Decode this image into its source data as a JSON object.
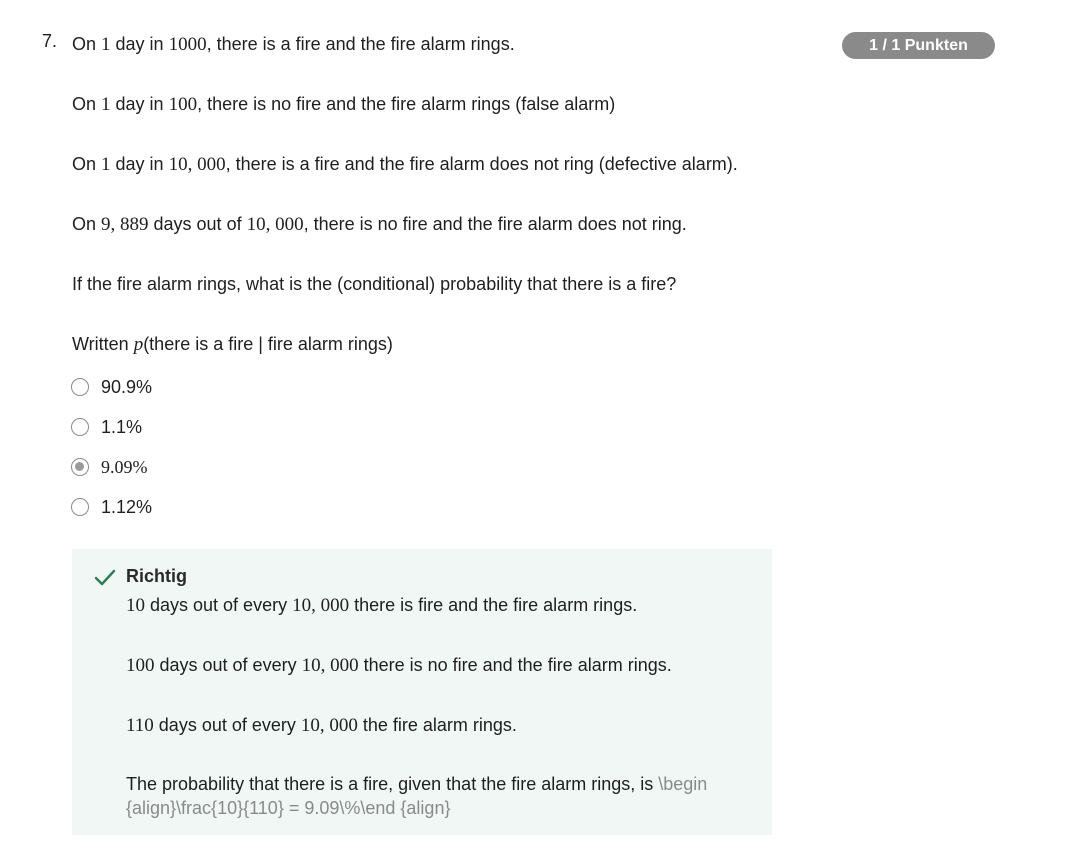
{
  "question": {
    "number": "7.",
    "score_badge": "1 / 1 Punkten",
    "paragraphs": [
      [
        "On ",
        "1",
        " day in ",
        "1000",
        ", there is a fire and the fire alarm rings."
      ],
      [
        "On ",
        "1",
        " day in ",
        "100",
        ", there is no fire and the fire alarm rings (false alarm)"
      ],
      [
        "On ",
        "1",
        " day in ",
        "10, 000",
        ", there is a fire and the fire alarm does not ring (defective alarm)."
      ],
      [
        "On ",
        "9, 889",
        " days out of ",
        "10, 000",
        ", there is no fire and the fire alarm does not ring."
      ]
    ],
    "prompt": "If the fire alarm rings, what is the (conditional) probability that there is a fire?",
    "notation": {
      "prefix": "Written ",
      "math": "p",
      "rest": "(there is a fire | fire alarm rings)"
    }
  },
  "options": [
    {
      "label": "90.9%",
      "selected": false
    },
    {
      "label": "1.1%",
      "selected": false
    },
    {
      "label": "9.09%",
      "selected": true
    },
    {
      "label": "1.12%",
      "selected": false
    }
  ],
  "feedback": {
    "status": "Richtig",
    "status_color": "#2e7d4f",
    "background_color": "#f0f7f5",
    "icon": "checkmark-icon",
    "lines": [
      [
        "10",
        " days out of every ",
        "10, 000",
        " there is fire and the fire alarm rings."
      ],
      [
        "100",
        " days out of every ",
        "10, 000",
        " there is no fire and the fire alarm rings."
      ],
      [
        "110",
        " days out of every ",
        "10, 000",
        " the fire alarm rings."
      ]
    ],
    "conclusion_text": "The probability that there is a fire, given that the fire alarm rings, is ",
    "conclusion_latex": "\\begin {align}\\frac{10}{110} = 9.09\\%\\end {align}"
  }
}
